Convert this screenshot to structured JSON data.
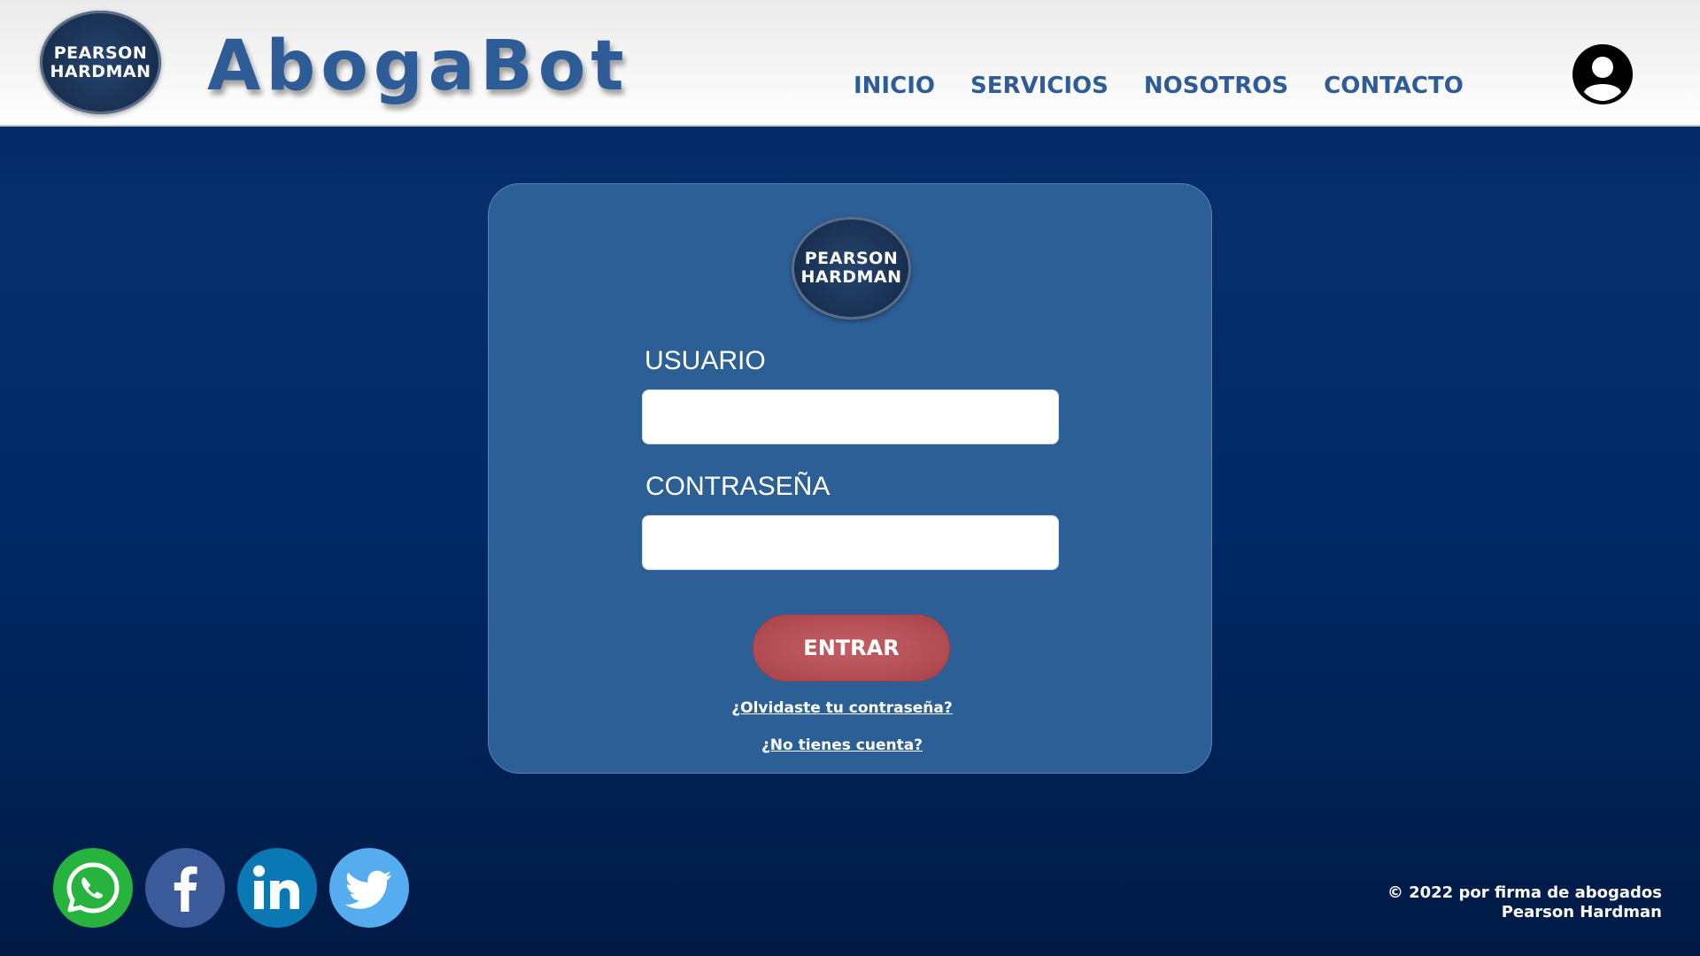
{
  "header": {
    "logo_line1": "PEARSON",
    "logo_line2": "HARDMAN",
    "brand": "AbogaBot",
    "nav": [
      "INICIO",
      "SERVICIOS",
      "NOSOTROS",
      "CONTACTO"
    ],
    "user_icon": "user-circle-icon"
  },
  "login": {
    "logo_line1": "PEARSON",
    "logo_line2": "HARDMAN",
    "username_label": "USUARIO",
    "username_value": "",
    "password_label": "CONTRASEÑA",
    "password_value": "",
    "submit_label": "ENTRAR",
    "forgot_link": "¿Olvidaste tu contraseña?",
    "signup_link": "¿No tienes cuenta?"
  },
  "footer": {
    "social": [
      {
        "name": "whatsapp",
        "icon": "whatsapp-icon"
      },
      {
        "name": "facebook",
        "icon": "facebook-icon"
      },
      {
        "name": "linkedin",
        "icon": "linkedin-icon"
      },
      {
        "name": "twitter",
        "icon": "twitter-icon"
      }
    ],
    "copyright_line1": "© 2022 por firma de abogados",
    "copyright_line2": "Pearson Hardman"
  },
  "colors": {
    "header_bg": "#ffffff",
    "brand_blue": "#2e5c96",
    "page_bg_dark": "#001a45",
    "card_bg": "#2d5f97",
    "button_red": "#b44f55",
    "whatsapp": "#27b43e",
    "facebook": "#3b5a9a",
    "linkedin": "#0a78b5",
    "twitter": "#55acee"
  }
}
